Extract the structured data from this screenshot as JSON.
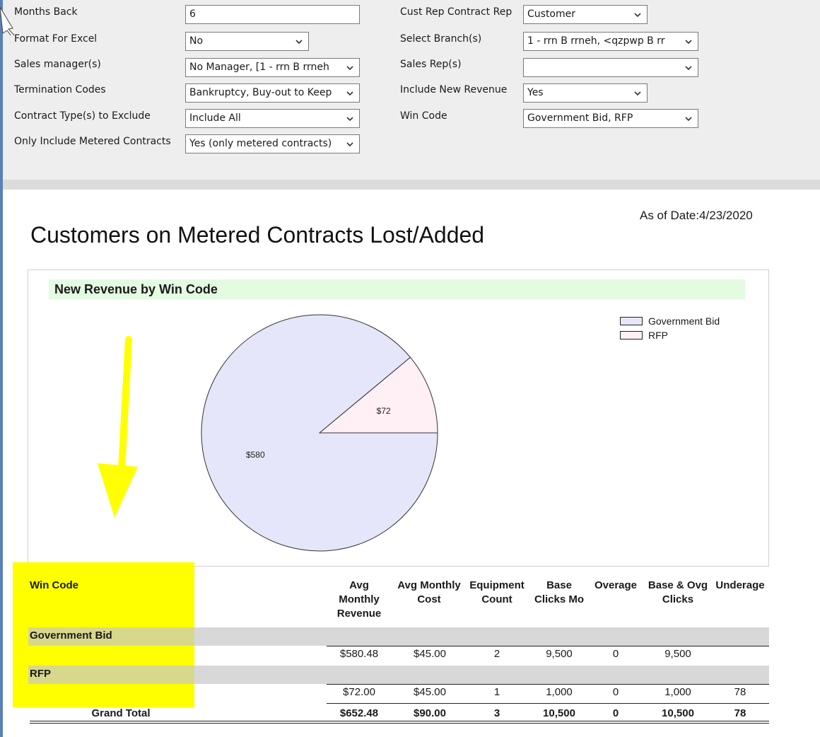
{
  "params": {
    "months_back": {
      "label": "Months Back",
      "value": "6"
    },
    "format_excel": {
      "label": "Format For Excel",
      "value": "No"
    },
    "sales_manager": {
      "label": "Sales manager(s)",
      "value": "No Manager, [1 -  rrn B rrneh"
    },
    "termination_codes": {
      "label": "Termination Codes",
      "value": "Bankruptcy, Buy-out to Keep"
    },
    "contract_types": {
      "label": "Contract Type(s) to Exclude",
      "value": "Include All"
    },
    "metered_only": {
      "label": "Only Include Metered Contracts",
      "value": "Yes (only metered contracts)"
    },
    "cust_rep": {
      "label": "Cust Rep Contract Rep",
      "value": "Customer"
    },
    "branch": {
      "label": "Select Branch(s)",
      "value": "1 -  rrn B rrneh, <qzpwp B rr"
    },
    "sales_rep": {
      "label": "Sales Rep(s)",
      "value": ""
    },
    "include_new_revenue": {
      "label": "Include New Revenue",
      "value": "Yes"
    },
    "win_code": {
      "label": "Win Code",
      "value": "Government Bid, RFP"
    }
  },
  "report": {
    "as_of": "As of Date:4/23/2020",
    "title": "Customers on Metered Contracts Lost/Added"
  },
  "chart_data": {
    "type": "pie",
    "title": "New Revenue by Win Code",
    "categories": [
      "Government Bid",
      "RFP"
    ],
    "values": [
      580,
      72
    ],
    "data_labels": [
      "$580",
      "$72"
    ],
    "colors": [
      "#e6e6fa",
      "#fff0f5"
    ],
    "legend": "top-right"
  },
  "table": {
    "headers": {
      "win_code": "Win Code",
      "avg_rev": [
        "Avg",
        "Monthly",
        "Revenue"
      ],
      "avg_cost": [
        "Avg Monthly",
        "Cost"
      ],
      "equip": [
        "Equipment",
        "Count"
      ],
      "base": [
        "Base",
        "Clicks Mo"
      ],
      "overage": [
        "Overage"
      ],
      "base_ovg": [
        "Base & Ovg",
        "Clicks"
      ],
      "underage": [
        "Underage"
      ]
    },
    "rows": [
      {
        "label": "Government Bid",
        "avg_rev": "$580.48",
        "avg_cost": "$45.00",
        "equip": "2",
        "base": "9,500",
        "overage": "0",
        "base_ovg": "9,500",
        "underage": ""
      },
      {
        "label": "RFP",
        "avg_rev": "$72.00",
        "avg_cost": "$45.00",
        "equip": "1",
        "base": "1,000",
        "overage": "0",
        "base_ovg": "1,000",
        "underage": "78"
      }
    ],
    "total": {
      "label": "Grand Total",
      "avg_rev": "$652.48",
      "avg_cost": "$90.00",
      "equip": "3",
      "base": "10,500",
      "overage": "0",
      "base_ovg": "10,500",
      "underage": "78"
    }
  },
  "colors": {
    "highlight": "#ffff00",
    "arrow": "#ffff00"
  }
}
